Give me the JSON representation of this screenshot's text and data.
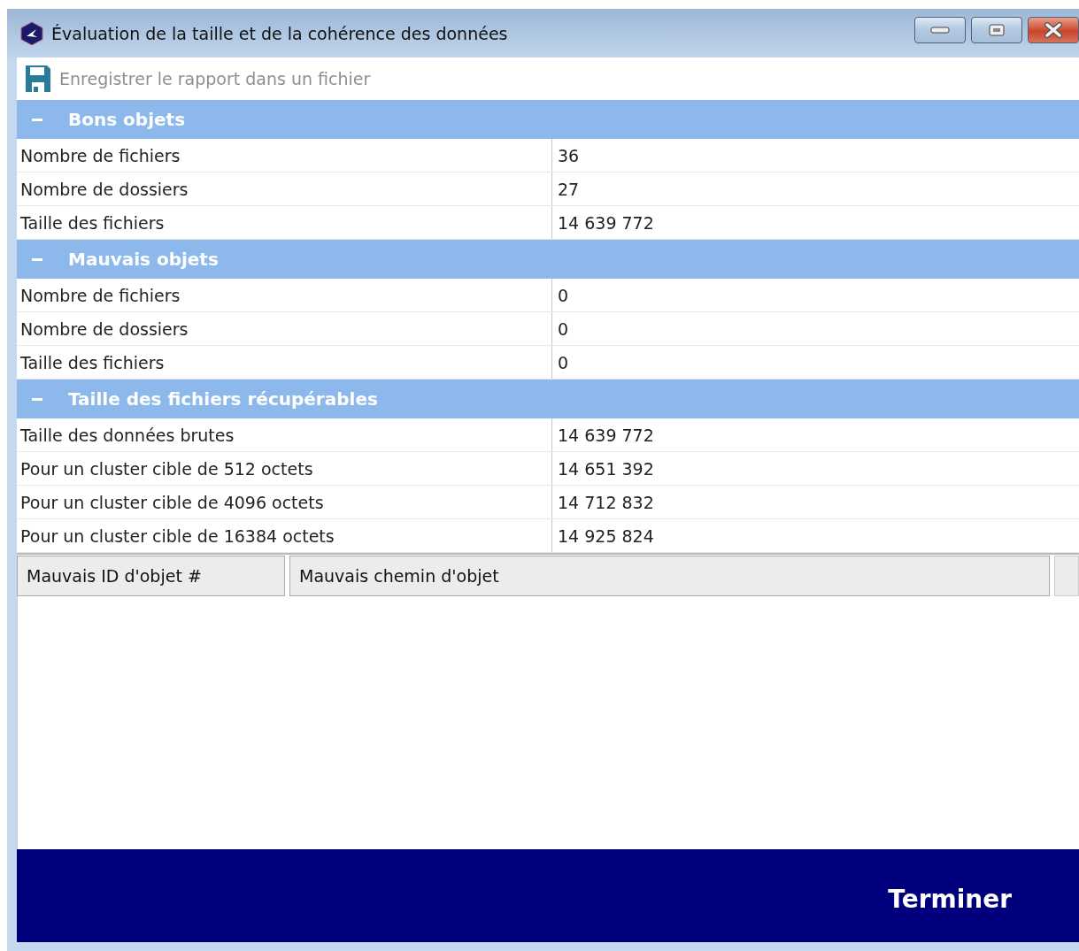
{
  "window": {
    "title": "Évaluation de la taille et de la cohérence des données"
  },
  "toolbar": {
    "save_label": "Enregistrer le rapport dans un fichier",
    "disabled": true
  },
  "sections": [
    {
      "title": "Bons objets",
      "expanded": true,
      "rows": [
        {
          "label": "Nombre de fichiers",
          "value": "36"
        },
        {
          "label": "Nombre de dossiers",
          "value": "27"
        },
        {
          "label": "Taille des fichiers",
          "value": "14 639 772"
        }
      ]
    },
    {
      "title": "Mauvais objets",
      "expanded": true,
      "rows": [
        {
          "label": "Nombre de fichiers",
          "value": "0"
        },
        {
          "label": "Nombre de dossiers",
          "value": "0"
        },
        {
          "label": "Taille des fichiers",
          "value": "0"
        }
      ]
    },
    {
      "title": "Taille des fichiers récupérables",
      "expanded": true,
      "rows": [
        {
          "label": "Taille des données brutes",
          "value": "14 639 772"
        },
        {
          "label": "Pour un cluster cible de 512 octets",
          "value": "14 651 392"
        },
        {
          "label": "Pour un cluster cible de 4096 octets",
          "value": "14 712 832"
        },
        {
          "label": "Pour un cluster cible de 16384 octets",
          "value": "14 925 824"
        }
      ]
    }
  ],
  "table": {
    "columns": [
      "Mauvais ID d'objet #",
      "Mauvais chemin d'objet"
    ]
  },
  "footer": {
    "button": "Terminer"
  }
}
